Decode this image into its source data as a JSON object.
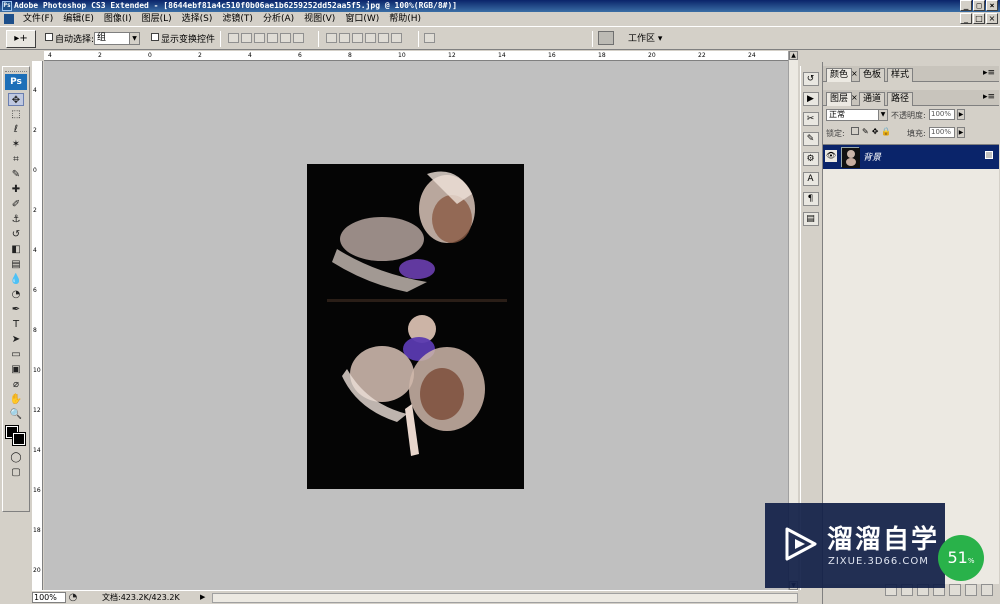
{
  "window": {
    "title": "Adobe Photoshop CS3 Extended - [8644ebf81a4c510f0b06ae1b6259252dd52aa5f5.jpg @ 100%(RGB/8#)]",
    "app_icon": "Ps",
    "minimize": "_",
    "maximize": "□",
    "close": "×"
  },
  "menu": [
    "文件(F)",
    "编辑(E)",
    "图像(I)",
    "图层(L)",
    "选择(S)",
    "滤镜(T)",
    "分析(A)",
    "视图(V)",
    "窗口(W)",
    "帮助(H)"
  ],
  "options": {
    "tool_preset": "▸+",
    "auto_select_label": "自动选择:",
    "auto_select_value": "组",
    "show_transform_label": "显示变换控件",
    "workspace_label": "工作区 ▾"
  },
  "ruler_h": [
    "4",
    "2",
    "0",
    "2",
    "4",
    "6",
    "8",
    "10",
    "12",
    "14",
    "16",
    "18",
    "20",
    "22",
    "24"
  ],
  "ruler_v": [
    "4",
    "2",
    "0",
    "2",
    "4",
    "6",
    "8",
    "10",
    "12",
    "14",
    "16",
    "18",
    "20"
  ],
  "toolbox": {
    "logo": "Ps",
    "tools": [
      {
        "name": "move-tool",
        "glyph": "✥"
      },
      {
        "name": "marquee-tool",
        "glyph": "⬚"
      },
      {
        "name": "lasso-tool",
        "glyph": "ℓ"
      },
      {
        "name": "magic-wand-tool",
        "glyph": "✶"
      },
      {
        "name": "crop-tool",
        "glyph": "⌗"
      },
      {
        "name": "slice-tool",
        "glyph": "✎"
      },
      {
        "name": "healing-brush-tool",
        "glyph": "✚"
      },
      {
        "name": "brush-tool",
        "glyph": "✐"
      },
      {
        "name": "clone-stamp-tool",
        "glyph": "⚓"
      },
      {
        "name": "history-brush-tool",
        "glyph": "↺"
      },
      {
        "name": "eraser-tool",
        "glyph": "◧"
      },
      {
        "name": "gradient-tool",
        "glyph": "▤"
      },
      {
        "name": "blur-tool",
        "glyph": "💧"
      },
      {
        "name": "dodge-tool",
        "glyph": "◔"
      },
      {
        "name": "pen-tool",
        "glyph": "✒"
      },
      {
        "name": "type-tool",
        "glyph": "T"
      },
      {
        "name": "path-selection-tool",
        "glyph": "➤"
      },
      {
        "name": "shape-tool",
        "glyph": "▭"
      },
      {
        "name": "notes-tool",
        "glyph": "▣"
      },
      {
        "name": "eyedropper-tool",
        "glyph": "⌀"
      },
      {
        "name": "hand-tool",
        "glyph": "✋"
      },
      {
        "name": "zoom-tool",
        "glyph": "🔍"
      }
    ]
  },
  "statusbar": {
    "zoom": "100%",
    "doc_info": "文档:423.2K/423.2K",
    "arrow": "▶"
  },
  "panels": {
    "color_tabs": [
      "颜色",
      "色板",
      "样式"
    ],
    "layer_tabs": [
      "图层",
      "通道",
      "路径"
    ],
    "panel_menu": "▸≡",
    "blend_mode": "正常",
    "opacity_label": "不透明度:",
    "opacity_value": "100%",
    "lock_label": "锁定:",
    "fill_label": "填充:",
    "fill_value": "100%",
    "layer_name": "背景"
  },
  "dock_icons": [
    "history-icon",
    "actions-icon",
    "tool-presets-icon",
    "brushes-icon",
    "clone-source-icon",
    "character-icon",
    "paragraph-icon",
    "layer-comps-icon"
  ],
  "watermark": {
    "title": "溜溜自学",
    "url": "ZIXUE.3D66.COM"
  },
  "badge": {
    "value": "51",
    "suffix": "%"
  }
}
